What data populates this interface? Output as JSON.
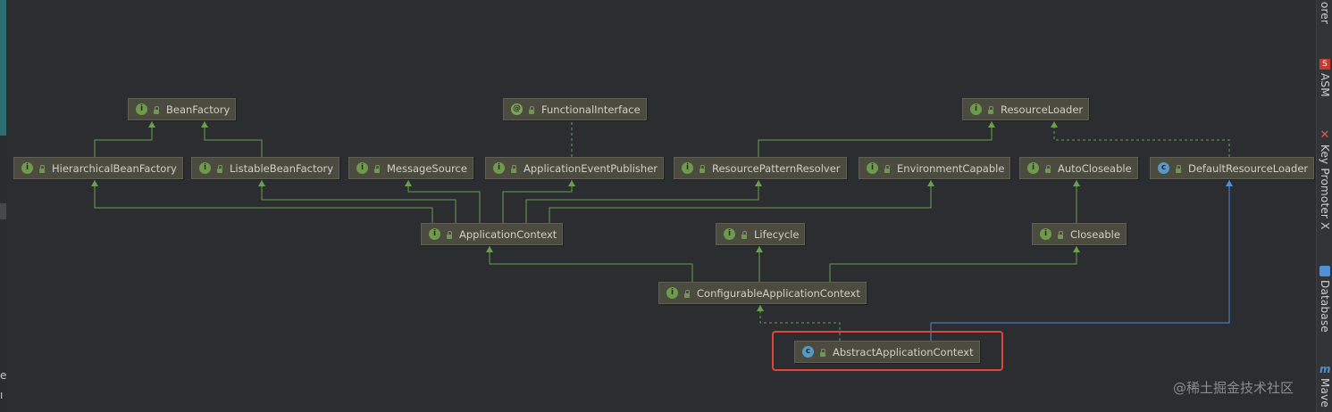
{
  "diagram": {
    "nodes": [
      {
        "id": "BeanFactory",
        "label": "BeanFactory",
        "kind": "I"
      },
      {
        "id": "FunctionalInterface",
        "label": "FunctionalInterface",
        "kind": "@"
      },
      {
        "id": "ResourceLoader",
        "label": "ResourceLoader",
        "kind": "I"
      },
      {
        "id": "HierarchicalBeanFactory",
        "label": "HierarchicalBeanFactory",
        "kind": "I"
      },
      {
        "id": "ListableBeanFactory",
        "label": "ListableBeanFactory",
        "kind": "I"
      },
      {
        "id": "MessageSource",
        "label": "MessageSource",
        "kind": "I"
      },
      {
        "id": "ApplicationEventPublisher",
        "label": "ApplicationEventPublisher",
        "kind": "I"
      },
      {
        "id": "ResourcePatternResolver",
        "label": "ResourcePatternResolver",
        "kind": "I"
      },
      {
        "id": "EnvironmentCapable",
        "label": "EnvironmentCapable",
        "kind": "I"
      },
      {
        "id": "AutoCloseable",
        "label": "AutoCloseable",
        "kind": "I"
      },
      {
        "id": "DefaultResourceLoader",
        "label": "DefaultResourceLoader",
        "kind": "C"
      },
      {
        "id": "ApplicationContext",
        "label": "ApplicationContext",
        "kind": "I"
      },
      {
        "id": "Lifecycle",
        "label": "Lifecycle",
        "kind": "I"
      },
      {
        "id": "Closeable",
        "label": "Closeable",
        "kind": "I"
      },
      {
        "id": "ConfigurableApplicationContext",
        "label": "ConfigurableApplicationContext",
        "kind": "I"
      },
      {
        "id": "AbstractApplicationContext",
        "label": "AbstractApplicationContext",
        "kind": "C"
      }
    ],
    "edges": [
      {
        "from": "HierarchicalBeanFactory",
        "to": "BeanFactory",
        "type": "extends"
      },
      {
        "from": "ListableBeanFactory",
        "to": "BeanFactory",
        "type": "extends"
      },
      {
        "from": "ApplicationEventPublisher",
        "to": "FunctionalInterface",
        "type": "annotated"
      },
      {
        "from": "ResourcePatternResolver",
        "to": "ResourceLoader",
        "type": "extends"
      },
      {
        "from": "DefaultResourceLoader",
        "to": "ResourceLoader",
        "type": "implements"
      },
      {
        "from": "ApplicationContext",
        "to": "HierarchicalBeanFactory",
        "type": "extends"
      },
      {
        "from": "ApplicationContext",
        "to": "ListableBeanFactory",
        "type": "extends"
      },
      {
        "from": "ApplicationContext",
        "to": "MessageSource",
        "type": "extends"
      },
      {
        "from": "ApplicationContext",
        "to": "ApplicationEventPublisher",
        "type": "extends"
      },
      {
        "from": "ApplicationContext",
        "to": "ResourcePatternResolver",
        "type": "extends"
      },
      {
        "from": "ApplicationContext",
        "to": "EnvironmentCapable",
        "type": "extends"
      },
      {
        "from": "Closeable",
        "to": "AutoCloseable",
        "type": "extends"
      },
      {
        "from": "ConfigurableApplicationContext",
        "to": "ApplicationContext",
        "type": "extends"
      },
      {
        "from": "ConfigurableApplicationContext",
        "to": "Lifecycle",
        "type": "extends"
      },
      {
        "from": "ConfigurableApplicationContext",
        "to": "Closeable",
        "type": "extends"
      },
      {
        "from": "AbstractApplicationContext",
        "to": "ConfigurableApplicationContext",
        "type": "implements"
      },
      {
        "from": "AbstractApplicationContext",
        "to": "DefaultResourceLoader",
        "type": "class-extends"
      }
    ],
    "highlighted_node": "AbstractApplicationContext"
  },
  "sidebar": {
    "tools": [
      {
        "label": "orer"
      },
      {
        "label": "ASM",
        "icon": "asm-icon"
      },
      {
        "label": "Key Promoter X",
        "icon": "key-promoter-icon"
      },
      {
        "label": "Database",
        "icon": "database-icon"
      },
      {
        "label": "Mave",
        "icon": "maven-icon"
      }
    ]
  },
  "left_glyphs": [
    "e",
    "ı"
  ],
  "watermark": "@稀土掘金技术社区",
  "colors": {
    "background": "#2b2d31",
    "node_fill": "#4b4b40",
    "edge_green": "#6a9f4f",
    "edge_blue": "#4f8fd8",
    "highlight": "#e0453a"
  }
}
